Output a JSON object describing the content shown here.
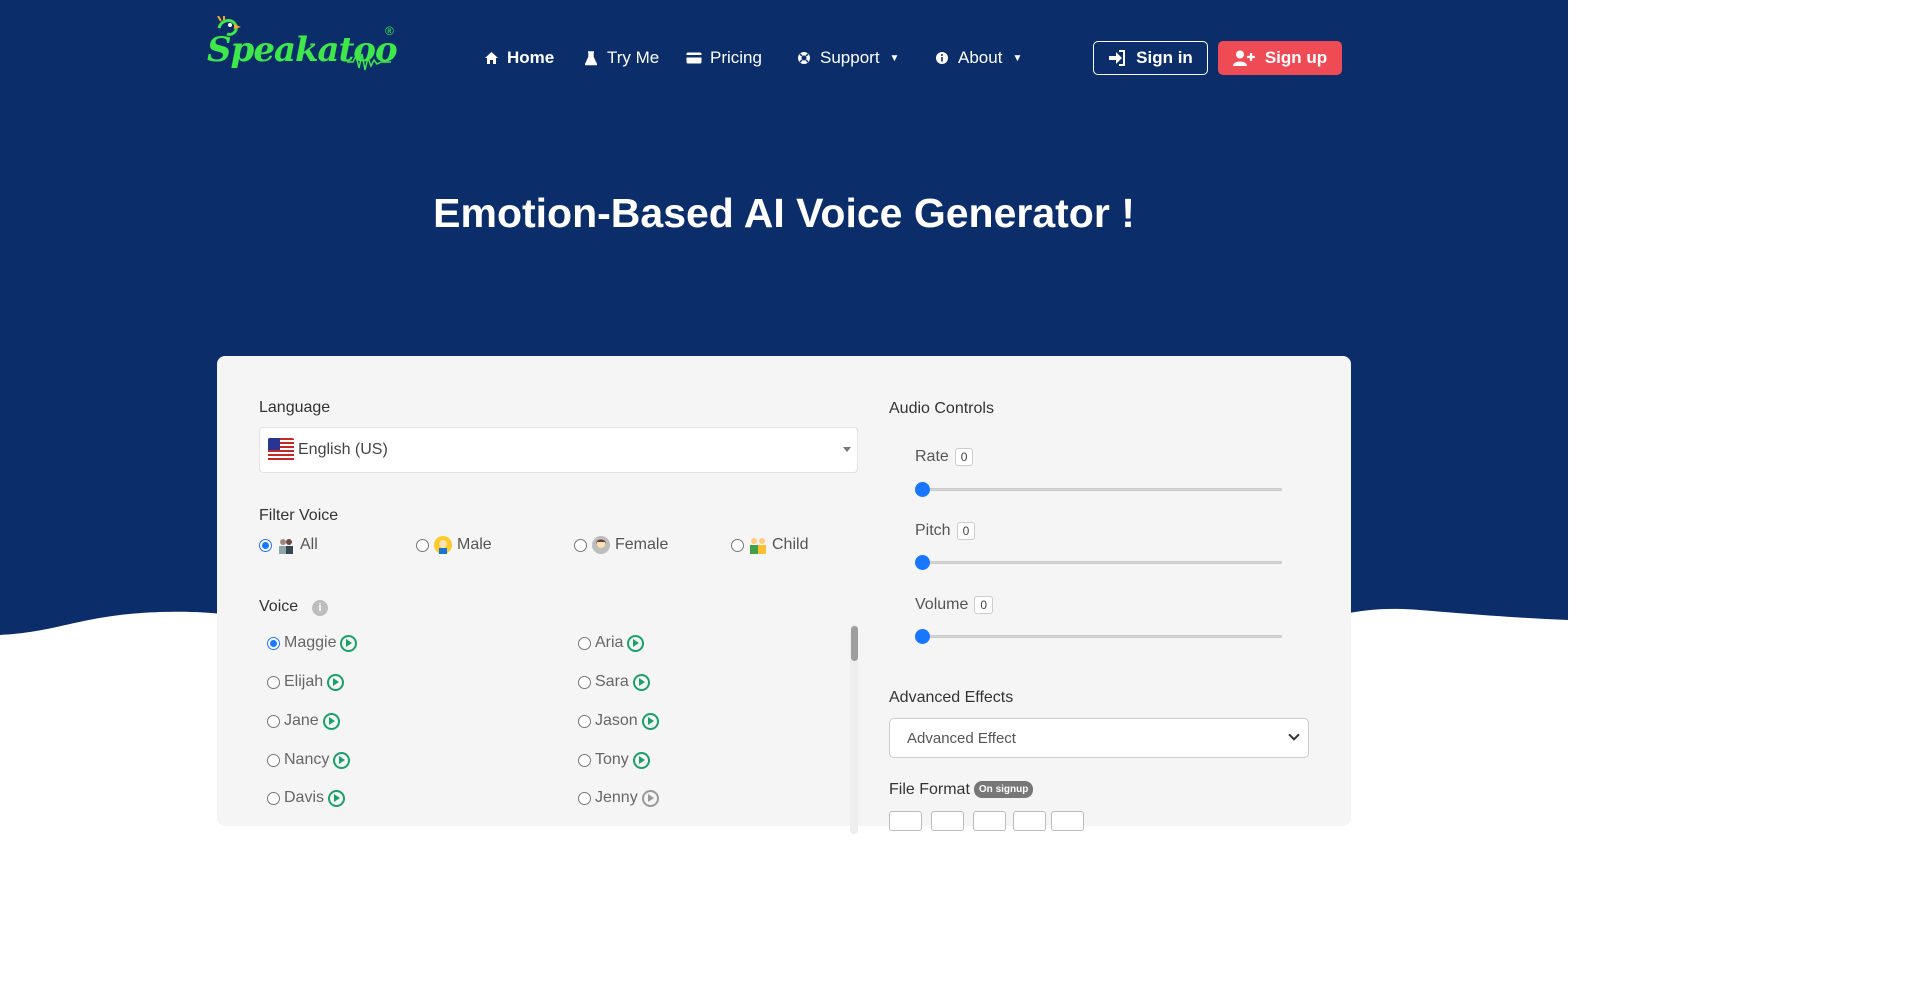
{
  "brand": {
    "name": "Speakatoo",
    "reg": "®"
  },
  "nav": {
    "items": [
      {
        "label": "Home",
        "icon": "home-icon",
        "active": true,
        "dropdown": false
      },
      {
        "label": "Try Me",
        "icon": "flask-icon",
        "active": false,
        "dropdown": false
      },
      {
        "label": "Pricing",
        "icon": "card-icon",
        "active": false,
        "dropdown": false
      },
      {
        "label": "Support",
        "icon": "support-icon",
        "active": false,
        "dropdown": true
      },
      {
        "label": "About",
        "icon": "info-icon",
        "active": false,
        "dropdown": true
      }
    ],
    "sign_in": "Sign in",
    "sign_up": "Sign up"
  },
  "hero": {
    "title": "Emotion-Based AI Voice Generator !"
  },
  "form": {
    "language_label": "Language",
    "language_value": "English (US)",
    "filter_label": "Filter Voice",
    "filters": [
      {
        "label": "All",
        "checked": true
      },
      {
        "label": "Male",
        "checked": false
      },
      {
        "label": "Female",
        "checked": false
      },
      {
        "label": "Child",
        "checked": false
      }
    ],
    "voice_label": "Voice",
    "voices_left": [
      {
        "name": "Maggie",
        "checked": true
      },
      {
        "name": "Elijah",
        "checked": false
      },
      {
        "name": "Jane",
        "checked": false
      },
      {
        "name": "Nancy",
        "checked": false
      },
      {
        "name": "Davis",
        "checked": false
      }
    ],
    "voices_right": [
      {
        "name": "Aria",
        "checked": false
      },
      {
        "name": "Sara",
        "checked": false
      },
      {
        "name": "Jason",
        "checked": false
      },
      {
        "name": "Tony",
        "checked": false
      },
      {
        "name": "Jenny",
        "checked": false
      }
    ]
  },
  "audio": {
    "title": "Audio Controls",
    "rate_label": "Rate",
    "rate_value": "0",
    "pitch_label": "Pitch",
    "pitch_value": "0",
    "volume_label": "Volume",
    "volume_value": "0"
  },
  "effects": {
    "title": "Advanced Effects",
    "selected": "Advanced Effect"
  },
  "format": {
    "title": "File Format",
    "badge": "On signup"
  },
  "colors": {
    "hero_bg": "#0b2e6b",
    "accent": "#1976ff",
    "signup": "#ef4b55",
    "logo": "#3fe84a",
    "play": "#1aa06a"
  }
}
